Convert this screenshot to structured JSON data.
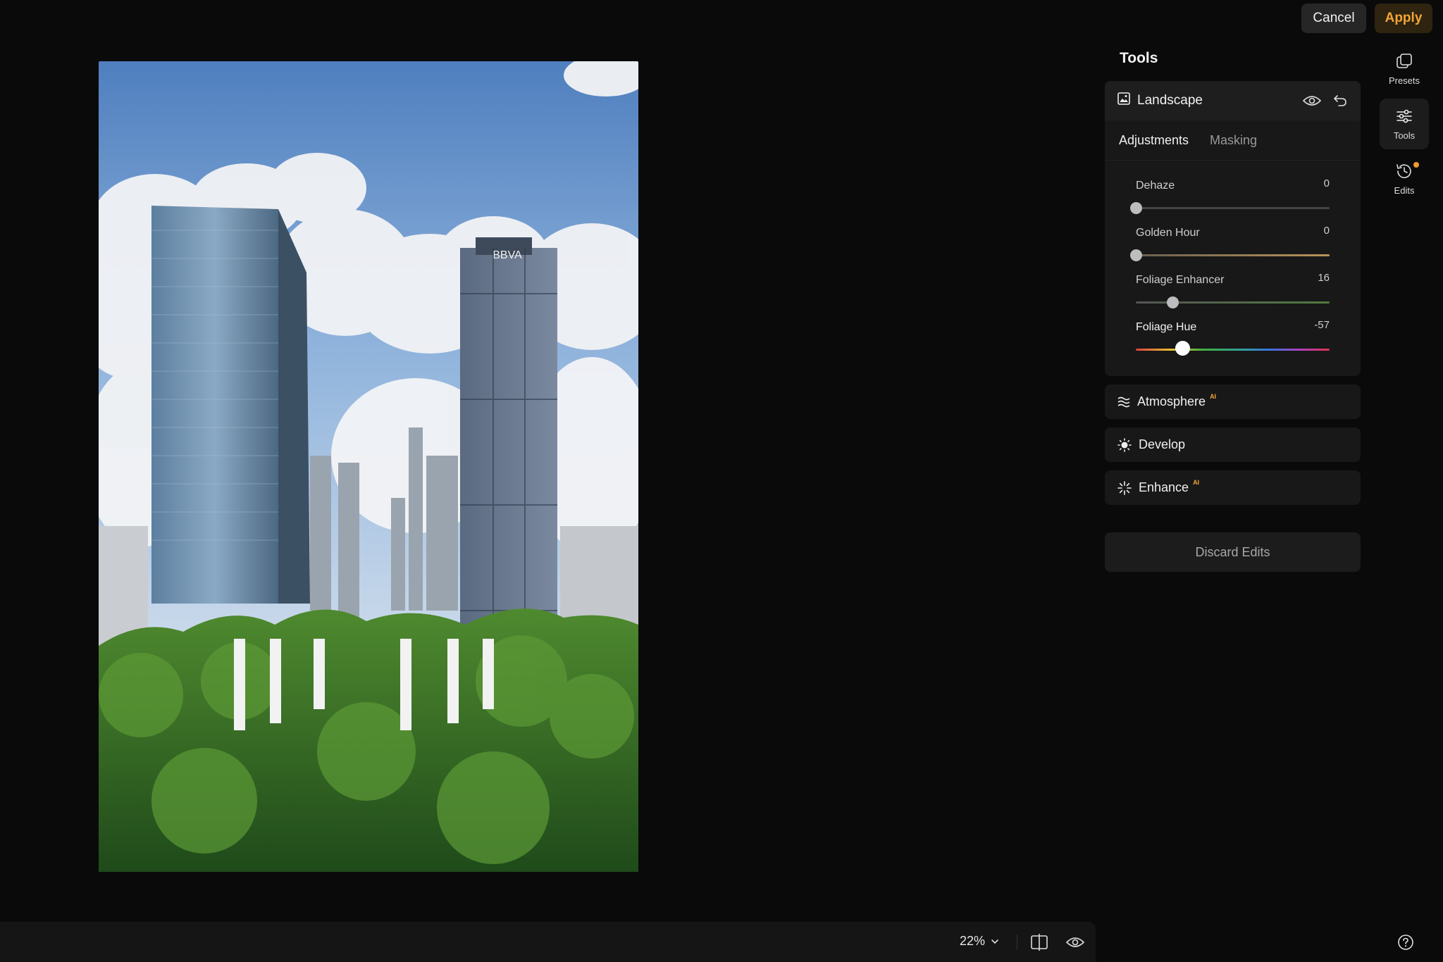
{
  "top": {
    "cancel": "Cancel",
    "apply": "Apply"
  },
  "rail": {
    "presets": "Presets",
    "tools": "Tools",
    "edits": "Edits"
  },
  "panel": {
    "title": "Tools",
    "landscape": {
      "title": "Landscape",
      "tabs": [
        "Adjustments",
        "Masking"
      ],
      "sliders": [
        {
          "label": "Dehaze",
          "value": "0",
          "position": 0.0
        },
        {
          "label": "Golden Hour",
          "value": "0",
          "position": 0.0
        },
        {
          "label": "Foliage Enhancer",
          "value": "16",
          "position": 0.19
        },
        {
          "label": "Foliage Hue",
          "value": "-57",
          "position": 0.24
        }
      ]
    },
    "sections": [
      {
        "label": "Atmosphere",
        "badge": "AI"
      },
      {
        "label": "Develop",
        "badge": ""
      },
      {
        "label": "Enhance",
        "badge": "AI"
      }
    ],
    "discard": "Discard Edits"
  },
  "bottom": {
    "zoom": "22%"
  },
  "colors": {
    "accent": "#f2a536",
    "edit_dot": "#f29a2e"
  }
}
